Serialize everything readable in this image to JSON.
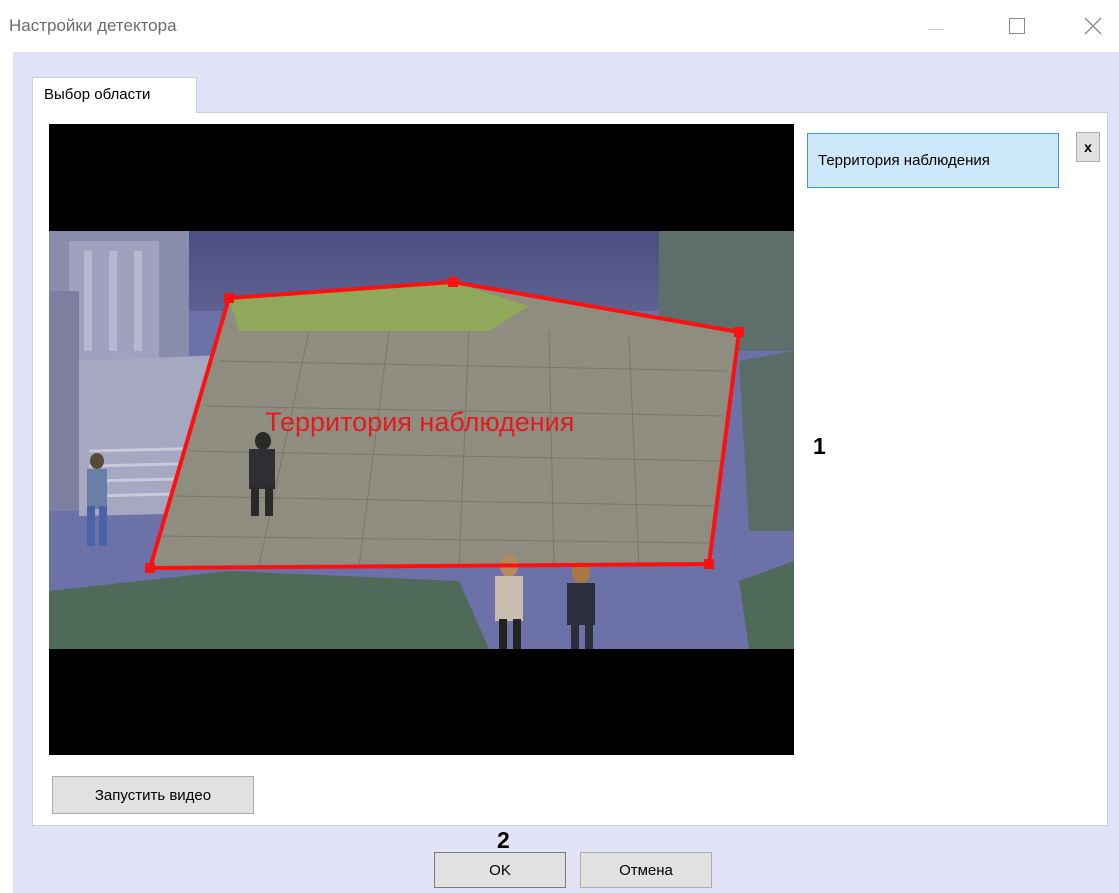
{
  "window": {
    "title": "Настройки детектора",
    "controls": [
      "minimize-icon",
      "maximize-icon",
      "close-icon"
    ]
  },
  "tab": {
    "label": "Выбор области"
  },
  "video": {
    "zone_label": "Территория наблюдения",
    "zone_color": "#e8191e"
  },
  "zones_list": {
    "items": [
      {
        "label": "Территория наблюдения",
        "selected": true
      }
    ],
    "delete_label": "x"
  },
  "buttons": {
    "play_video": "Запустить видео",
    "ok": "OK",
    "cancel": "Отмена"
  },
  "callouts": {
    "one": "1",
    "two": "2"
  }
}
